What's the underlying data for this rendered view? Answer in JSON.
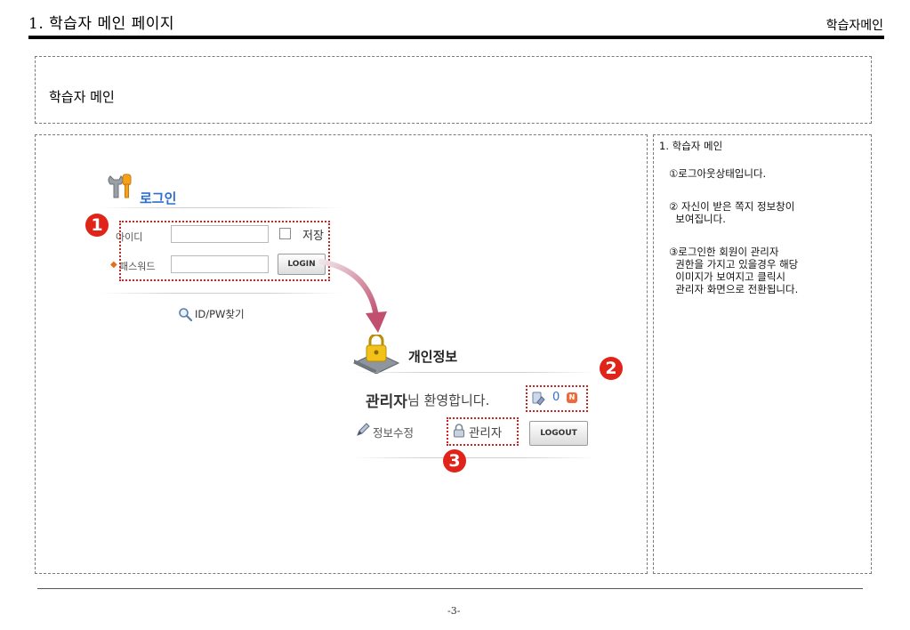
{
  "header": {
    "title": "1. 학습자 메인 페이지",
    "section": "학습자메인"
  },
  "screen_title": "학습자 메인",
  "login_panel": {
    "title": "로그인",
    "id_label": "아이디",
    "password_label": "패스워드",
    "save_label": "저장",
    "login_button": "LOGIN",
    "find_link": "ID/PW찾기"
  },
  "profile_panel": {
    "title": "개인정보",
    "welcome_name": "관리자",
    "welcome_suffix": "님 환영합니다.",
    "message_count": "0",
    "new_badge": "N",
    "edit_link": "정보수정",
    "admin_link": "관리자",
    "logout_button": "LOGOUT"
  },
  "markers": [
    "1",
    "2",
    "3"
  ],
  "description": {
    "heading": "1. 학습자 메인",
    "items": [
      "①로그아웃상태입니다.",
      "② 자신이 받은 쪽지 정보창이\n  보여집니다.",
      "③로그인한 회원이 관리자\n  권한을 가지고 있을경우 해당\n  이미지가 보여지고 클릭시\n  관리자 화면으로 전환됩니다."
    ]
  },
  "footer": {
    "page_number": "-3-"
  },
  "colors": {
    "highlight": "#d12020",
    "login_title": "#2c6fd1",
    "marker": "#e0241a"
  },
  "icons": [
    "tools-icon",
    "search-icon",
    "lock-icon",
    "memo-icon",
    "pencil-icon",
    "padlock-icon",
    "arrow-icon"
  ]
}
